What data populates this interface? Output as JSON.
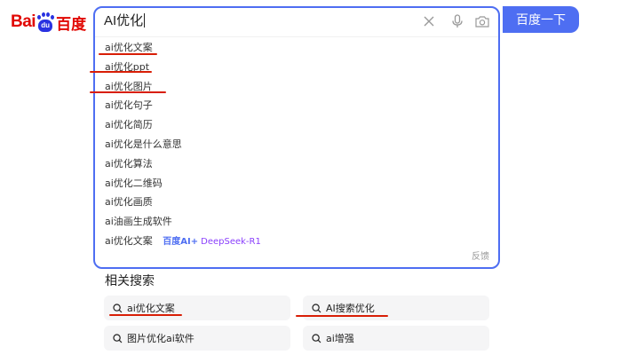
{
  "logo": {
    "bai": "Bai",
    "du": "du",
    "cn": "百度"
  },
  "search": {
    "query": "AI优化",
    "button_label": "百度一下",
    "clear_icon": "close-icon",
    "voice_icon": "microphone-icon",
    "camera_icon": "camera-icon"
  },
  "suggestions": [
    {
      "text": "ai优化文案"
    },
    {
      "text": "ai优化ppt"
    },
    {
      "text": "ai优化图片"
    },
    {
      "text": "ai优化句子"
    },
    {
      "text": "ai优化简历"
    },
    {
      "text": "ai优化是什么意思"
    },
    {
      "text": "ai优化算法"
    },
    {
      "text": "ai优化二维码"
    },
    {
      "text": "ai优化画质"
    },
    {
      "text": "ai油画生成软件"
    },
    {
      "text": "ai优化文案",
      "tag": "百度AI+",
      "tag_extra": "DeepSeek-R1"
    }
  ],
  "feedback_label": "反馈",
  "related": {
    "title": "相关搜索",
    "items": [
      {
        "label": "ai优化文案"
      },
      {
        "label": "AI搜索优化"
      },
      {
        "label": "图片优化ai软件"
      },
      {
        "label": "ai增强"
      }
    ]
  },
  "colors": {
    "accent": "#4e6ef2",
    "brand_red": "#e10601",
    "brand_blue": "#2932e1",
    "annotation_red": "#d81e06"
  }
}
